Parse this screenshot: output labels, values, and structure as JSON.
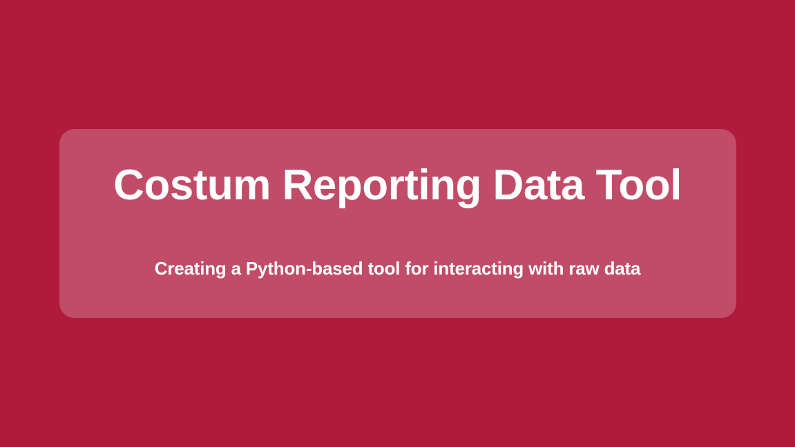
{
  "slide": {
    "title": "Costum Reporting Data Tool",
    "subtitle": "Creating a Python-based tool for interacting with raw data"
  },
  "colors": {
    "background": "#b01a3d",
    "cardOverlay": "rgba(255,255,255,0.22)",
    "text": "#ffffff"
  }
}
